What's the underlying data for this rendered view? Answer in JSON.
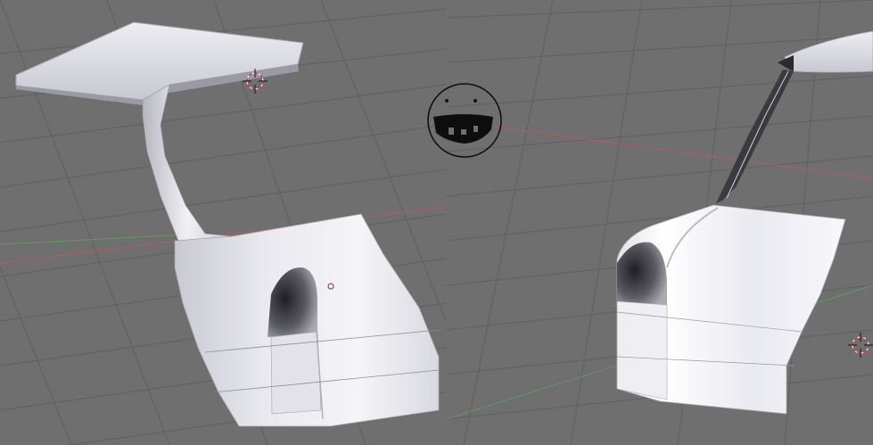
{
  "app": {
    "type": "3d-viewport",
    "views": [
      "left-3d-view",
      "right-3d-view"
    ]
  },
  "colors": {
    "background": "#6f6f6f",
    "grid": "#5d5d5d",
    "x_axis": "#b65b5b",
    "y_axis": "#5f9d5f",
    "mesh_light": "#f2f2f6",
    "mesh_mid": "#cfcfd8",
    "mesh_dark": "#7a7a82",
    "mesh_shadow": "#2a2a2e",
    "cursor_red": "#d43c3c",
    "cursor_black": "#111111"
  },
  "icons": {
    "left_cursor": "3d-cursor-icon",
    "right_cursor": "3d-cursor-icon",
    "smiley": "doodle-smiley-icon"
  }
}
